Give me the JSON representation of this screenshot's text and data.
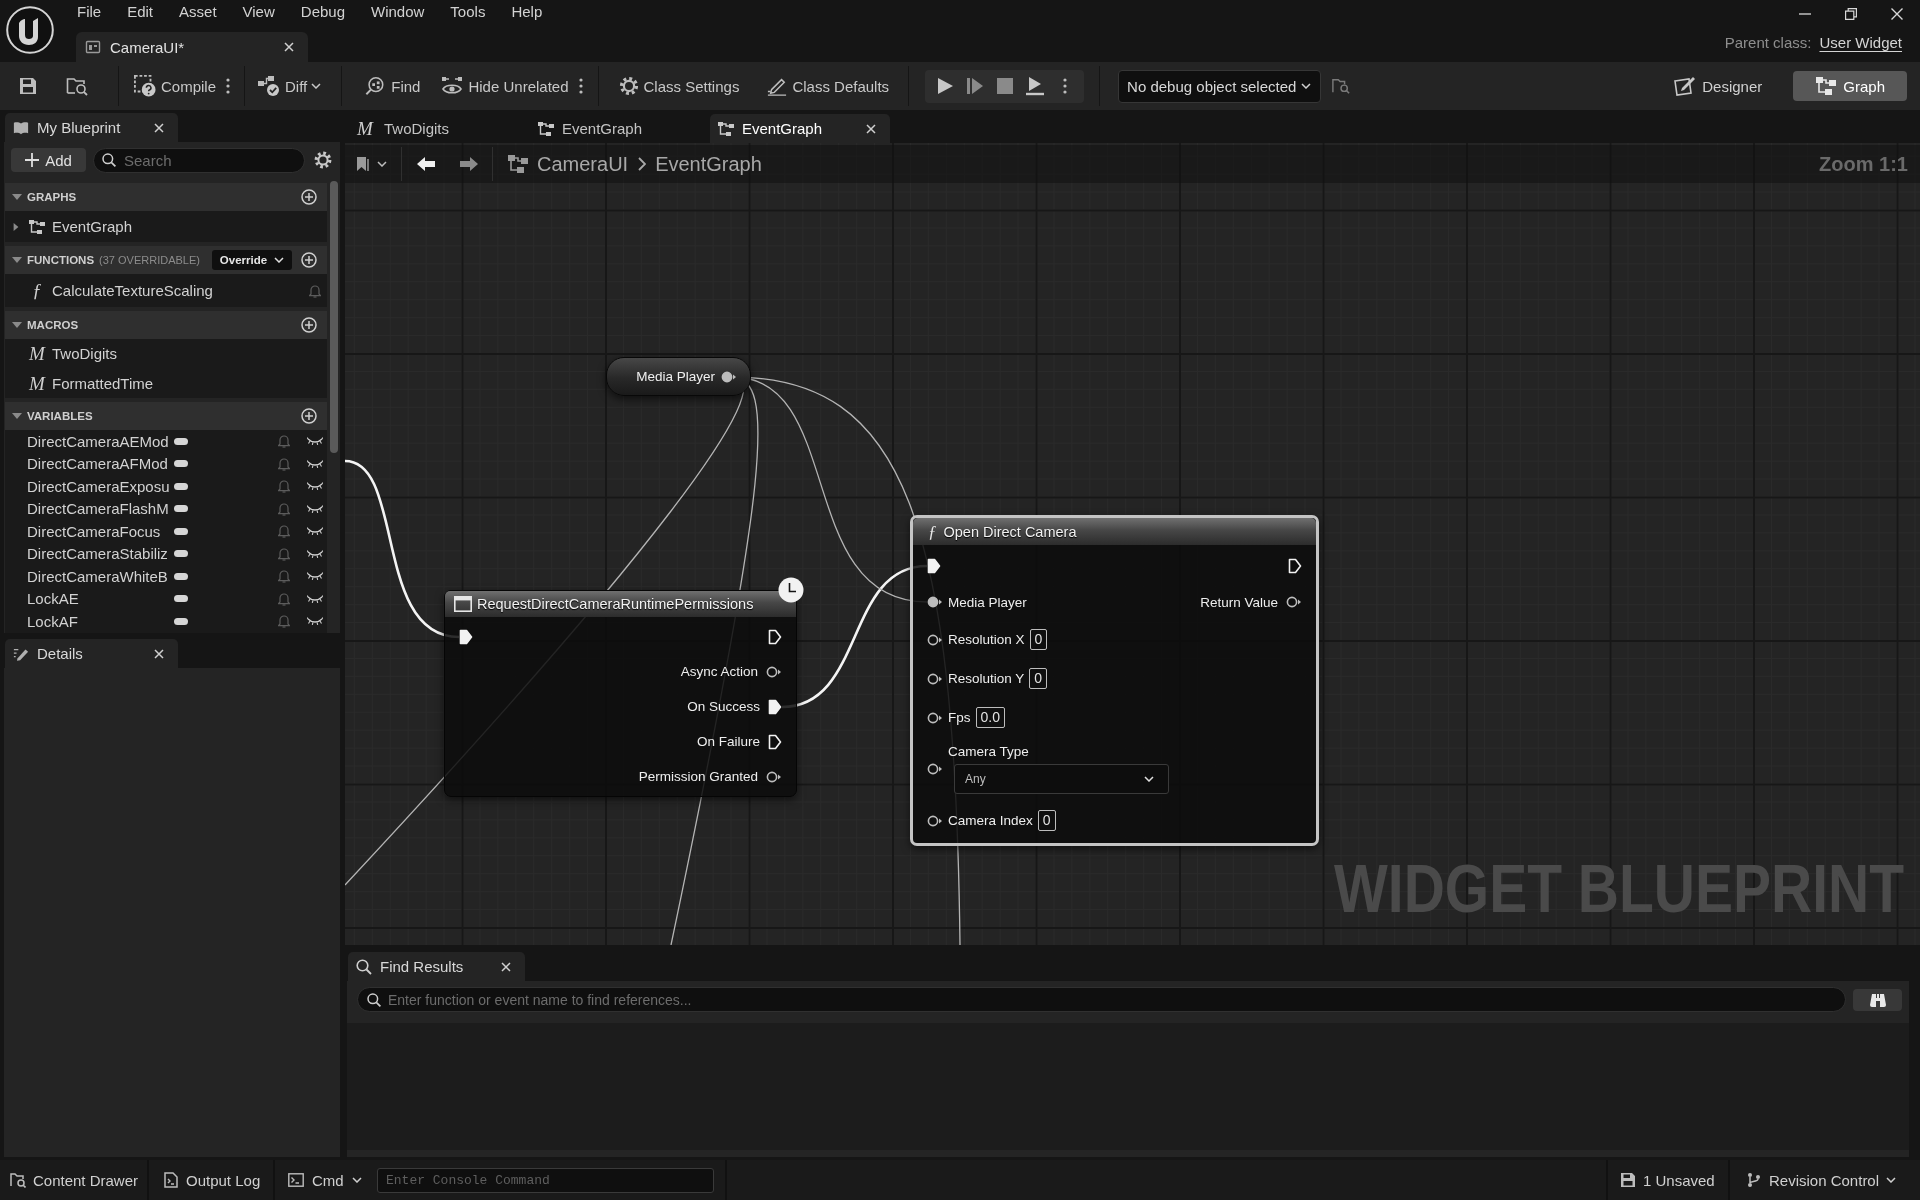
{
  "title_bar": {
    "menu": [
      "File",
      "Edit",
      "Asset",
      "View",
      "Debug",
      "Window",
      "Tools",
      "Help"
    ],
    "asset_tab": {
      "label": "CameraUI*"
    },
    "parent_class_label": "Parent class:",
    "parent_class": "User Widget"
  },
  "toolbar": {
    "compile": "Compile",
    "diff": "Diff",
    "find": "Find",
    "hide_unrelated": "Hide Unrelated",
    "class_settings": "Class Settings",
    "class_defaults": "Class Defaults",
    "debug_object": "No debug object selected",
    "modes": [
      {
        "label": "Designer",
        "selected": false
      },
      {
        "label": "Graph",
        "selected": true
      }
    ]
  },
  "my_blueprint": {
    "tab": "My Blueprint",
    "add_button": "Add",
    "search": {
      "placeholder": "Search"
    },
    "sections": [
      {
        "title": "GRAPHS",
        "expanded": true,
        "items": [
          {
            "kind": "graph",
            "label": "EventGraph",
            "expanded": false
          }
        ]
      },
      {
        "title": "FUNCTIONS",
        "note": "(37 OVERRIDABLE)",
        "dropdown": "Override",
        "expanded": true,
        "items": [
          {
            "kind": "function",
            "symbol": "ƒ",
            "label": "CalculateTextureScaling"
          }
        ]
      },
      {
        "title": "MACROS",
        "expanded": true,
        "items": [
          {
            "kind": "macro",
            "symbol": "M",
            "label": "TwoDigits"
          },
          {
            "kind": "macro",
            "symbol": "M",
            "label": "FormattedTime"
          }
        ]
      },
      {
        "title": "VARIABLES",
        "expanded": true,
        "items": [
          {
            "kind": "variable",
            "label": "DirectCameraAEMod"
          },
          {
            "kind": "variable",
            "label": "DirectCameraAFMod"
          },
          {
            "kind": "variable",
            "label": "DirectCameraExposu"
          },
          {
            "kind": "variable",
            "label": "DirectCameraFlashM"
          },
          {
            "kind": "variable",
            "label": "DirectCameraFocus"
          },
          {
            "kind": "variable",
            "label": "DirectCameraStabiliz"
          },
          {
            "kind": "variable",
            "label": "DirectCameraWhiteB"
          },
          {
            "kind": "variable",
            "label": "LockAE"
          },
          {
            "kind": "variable",
            "label": "LockAF"
          }
        ]
      }
    ]
  },
  "details": {
    "tab": "Details"
  },
  "document_tabs": [
    {
      "kind": "macro",
      "symbol": "M",
      "label": "TwoDigits",
      "selected": false
    },
    {
      "kind": "graph",
      "label": "EventGraph",
      "selected": false
    },
    {
      "kind": "graph",
      "label": "EventGraph",
      "selected": true
    }
  ],
  "graph": {
    "breadcrumb": [
      "CameraUI",
      "EventGraph"
    ],
    "zoom": "Zoom 1:1",
    "watermark": "WIDGET BLUEPRINT",
    "nodes": [
      {
        "kind": "variable",
        "label": "Media Player",
        "selected": false,
        "outputs": [
          {
            "kind": "data",
            "connected": true
          }
        ]
      },
      {
        "kind": "async",
        "title": "RequestDirectCameraRuntimePermissions",
        "selected": false,
        "inputs": [
          {
            "kind": "exec",
            "connected": true
          }
        ],
        "outputs": [
          {
            "kind": "exec",
            "connected": false
          },
          {
            "kind": "data",
            "label": "Async Action",
            "connected": false
          },
          {
            "kind": "exec",
            "label": "On Success",
            "connected": true
          },
          {
            "kind": "exec",
            "label": "On Failure",
            "connected": false
          },
          {
            "kind": "data",
            "label": "Permission Granted",
            "connected": false
          }
        ]
      },
      {
        "kind": "function",
        "symbol": "ƒ",
        "title": "Open Direct Camera",
        "selected": true,
        "inputs": [
          {
            "kind": "exec",
            "connected": true
          },
          {
            "kind": "data",
            "label": "Media Player",
            "connected": true
          },
          {
            "kind": "data",
            "label": "Resolution X",
            "value": "0",
            "connected": false
          },
          {
            "kind": "data",
            "label": "Resolution Y",
            "value": "0",
            "connected": false
          },
          {
            "kind": "data",
            "label": "Fps",
            "value": "0.0",
            "connected": false
          },
          {
            "kind": "enum",
            "label": "Camera Type",
            "value": "Any",
            "connected": false
          },
          {
            "kind": "data",
            "label": "Camera Index",
            "value": "0",
            "connected": false
          }
        ],
        "outputs": [
          {
            "kind": "exec",
            "connected": false
          },
          {
            "kind": "data",
            "label": "Return Value",
            "connected": false
          }
        ]
      }
    ]
  },
  "find_results": {
    "tab": "Find Results",
    "search": {
      "placeholder": "Enter function or event name to find references..."
    }
  },
  "status_bar": {
    "content_drawer": "Content Drawer",
    "output_log": "Output Log",
    "cmd": "Cmd",
    "console": {
      "placeholder": "Enter Console Command"
    },
    "unsaved": "1 Unsaved",
    "revision_control": "Revision Control"
  }
}
